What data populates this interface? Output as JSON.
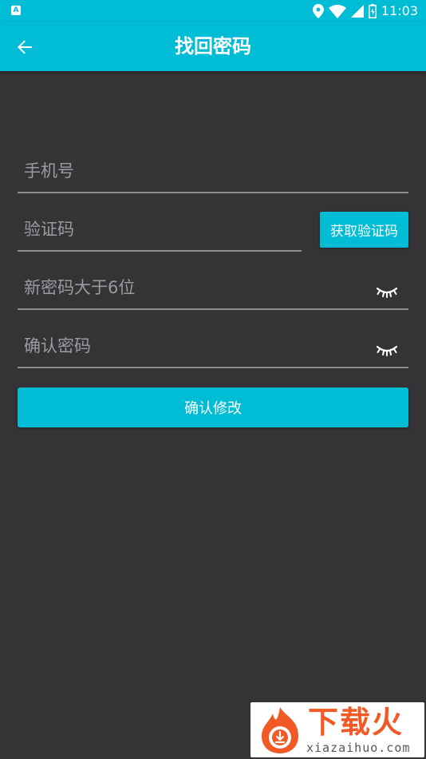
{
  "status_bar": {
    "left_icon_letter": "A",
    "time": "11:03",
    "icons": [
      "location-icon",
      "wifi-icon",
      "signal-icon",
      "battery-icon"
    ]
  },
  "app_bar": {
    "title": "找回密码",
    "back_icon": "arrow-left-icon"
  },
  "form": {
    "phone": {
      "placeholder": "手机号",
      "value": ""
    },
    "code": {
      "placeholder": "验证码",
      "value": ""
    },
    "get_code_label": "获取验证码",
    "new_password": {
      "placeholder": "新密码大于6位",
      "value": "",
      "icon": "eye-closed-icon"
    },
    "confirm_password": {
      "placeholder": "确认密码",
      "value": "",
      "icon": "eye-closed-icon"
    },
    "submit_label": "确认修改"
  },
  "watermark": {
    "brand": "下载火",
    "url": "xiazaihuo.com"
  },
  "colors": {
    "primary": "#00bcd4",
    "background": "#353336",
    "underline": "#8d8c8f",
    "placeholder": "#9c9a9e"
  }
}
